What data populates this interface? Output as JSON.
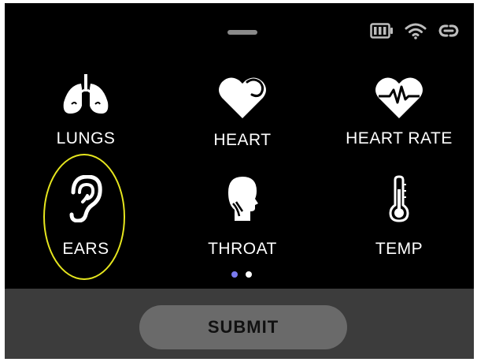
{
  "status_bar": {
    "icons": [
      "battery-icon",
      "wifi-icon",
      "link-icon"
    ]
  },
  "grid": {
    "items": [
      {
        "label": "LUNGS",
        "icon": "lungs-icon"
      },
      {
        "label": "HEART",
        "icon": "heart-icon"
      },
      {
        "label": "HEART RATE",
        "icon": "heart-rate-icon"
      },
      {
        "label": "EARS",
        "icon": "ear-icon",
        "highlighted": true
      },
      {
        "label": "THROAT",
        "icon": "throat-icon"
      },
      {
        "label": "TEMP",
        "icon": "thermometer-icon"
      }
    ]
  },
  "pagination": {
    "current_page": 1,
    "page_count": 2,
    "active_color": "#7b7bf0",
    "inactive_color": "#ffffff"
  },
  "footer": {
    "submit_label": "SUBMIT"
  },
  "colors": {
    "background": "#000000",
    "footer": "#3c3c3c",
    "button": "#6a6a6a",
    "highlight": "#e6e61e"
  }
}
